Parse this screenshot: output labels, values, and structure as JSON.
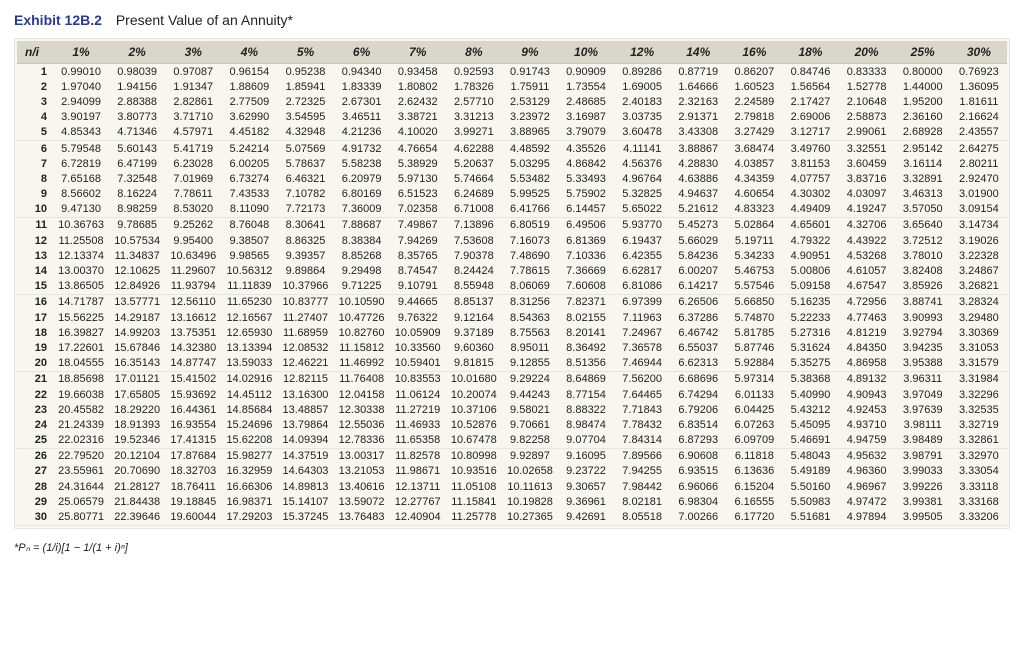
{
  "exhibit_label": "Exhibit 12B.2",
  "exhibit_title": "Present Value of an Annuity*",
  "row_header": "n/i",
  "columns": [
    "1%",
    "2%",
    "3%",
    "4%",
    "5%",
    "6%",
    "7%",
    "8%",
    "9%",
    "10%",
    "12%",
    "14%",
    "16%",
    "18%",
    "20%",
    "25%",
    "30%"
  ],
  "footnote": "*Pₙ = (1/i)[1 − 1/(1 + i)ⁿ]",
  "chart_data": {
    "type": "table",
    "title": "Exhibit 12B.2 Present Value of an Annuity",
    "x": [
      "1%",
      "2%",
      "3%",
      "4%",
      "5%",
      "6%",
      "7%",
      "8%",
      "9%",
      "10%",
      "12%",
      "14%",
      "16%",
      "18%",
      "20%",
      "25%",
      "30%"
    ],
    "rows": [
      {
        "n": 1,
        "v": [
          0.9901,
          0.98039,
          0.97087,
          0.96154,
          0.95238,
          0.9434,
          0.93458,
          0.92593,
          0.91743,
          0.90909,
          0.89286,
          0.87719,
          0.86207,
          0.84746,
          0.83333,
          0.8,
          0.76923
        ]
      },
      {
        "n": 2,
        "v": [
          1.9704,
          1.94156,
          1.91347,
          1.88609,
          1.85941,
          1.83339,
          1.80802,
          1.78326,
          1.75911,
          1.73554,
          1.69005,
          1.64666,
          1.60523,
          1.56564,
          1.52778,
          1.44,
          1.36095
        ]
      },
      {
        "n": 3,
        "v": [
          2.94099,
          2.88388,
          2.82861,
          2.77509,
          2.72325,
          2.67301,
          2.62432,
          2.5771,
          2.53129,
          2.48685,
          2.40183,
          2.32163,
          2.24589,
          2.17427,
          2.10648,
          1.952,
          1.81611
        ]
      },
      {
        "n": 4,
        "v": [
          3.90197,
          3.80773,
          3.7171,
          3.6299,
          3.54595,
          3.46511,
          3.38721,
          3.31213,
          3.23972,
          3.16987,
          3.03735,
          2.91371,
          2.79818,
          2.69006,
          2.58873,
          2.3616,
          2.16624
        ]
      },
      {
        "n": 5,
        "v": [
          4.85343,
          4.71346,
          4.57971,
          4.45182,
          4.32948,
          4.21236,
          4.1002,
          3.99271,
          3.88965,
          3.79079,
          3.60478,
          3.43308,
          3.27429,
          3.12717,
          2.99061,
          2.68928,
          2.43557
        ]
      },
      {
        "n": 6,
        "v": [
          5.79548,
          5.60143,
          5.41719,
          5.24214,
          5.07569,
          4.91732,
          4.76654,
          4.62288,
          4.48592,
          4.35526,
          4.11141,
          3.88867,
          3.68474,
          3.4976,
          3.32551,
          2.95142,
          2.64275
        ]
      },
      {
        "n": 7,
        "v": [
          6.72819,
          6.47199,
          6.23028,
          6.00205,
          5.78637,
          5.58238,
          5.38929,
          5.20637,
          5.03295,
          4.86842,
          4.56376,
          4.2883,
          4.03857,
          3.81153,
          3.60459,
          3.16114,
          2.80211
        ]
      },
      {
        "n": 8,
        "v": [
          7.65168,
          7.32548,
          7.01969,
          6.73274,
          6.46321,
          6.20979,
          5.9713,
          5.74664,
          5.53482,
          5.33493,
          4.96764,
          4.63886,
          4.34359,
          4.07757,
          3.83716,
          3.32891,
          2.9247
        ]
      },
      {
        "n": 9,
        "v": [
          8.56602,
          8.16224,
          7.78611,
          7.43533,
          7.10782,
          6.80169,
          6.51523,
          6.24689,
          5.99525,
          5.75902,
          5.32825,
          4.94637,
          4.60654,
          4.30302,
          4.03097,
          3.46313,
          3.019
        ]
      },
      {
        "n": 10,
        "v": [
          9.4713,
          8.98259,
          8.5302,
          8.1109,
          7.72173,
          7.36009,
          7.02358,
          6.71008,
          6.41766,
          6.14457,
          5.65022,
          5.21612,
          4.83323,
          4.49409,
          4.19247,
          3.5705,
          3.09154
        ]
      },
      {
        "n": 11,
        "v": [
          10.36763,
          9.78685,
          9.25262,
          8.76048,
          8.30641,
          7.88687,
          7.49867,
          7.13896,
          6.80519,
          6.49506,
          5.9377,
          5.45273,
          5.02864,
          4.65601,
          4.32706,
          3.6564,
          3.14734
        ]
      },
      {
        "n": 12,
        "v": [
          11.25508,
          10.57534,
          9.954,
          9.38507,
          8.86325,
          8.38384,
          7.94269,
          7.53608,
          7.16073,
          6.81369,
          6.19437,
          5.66029,
          5.19711,
          4.79322,
          4.43922,
          3.72512,
          3.19026
        ]
      },
      {
        "n": 13,
        "v": [
          12.13374,
          11.34837,
          10.63496,
          9.98565,
          9.39357,
          8.85268,
          8.35765,
          7.90378,
          7.4869,
          7.10336,
          6.42355,
          5.84236,
          5.34233,
          4.90951,
          4.53268,
          3.7801,
          3.22328
        ]
      },
      {
        "n": 14,
        "v": [
          13.0037,
          12.10625,
          11.29607,
          10.56312,
          9.89864,
          9.29498,
          8.74547,
          8.24424,
          7.78615,
          7.36669,
          6.62817,
          6.00207,
          5.46753,
          5.00806,
          4.61057,
          3.82408,
          3.24867
        ]
      },
      {
        "n": 15,
        "v": [
          13.86505,
          12.84926,
          11.93794,
          11.11839,
          10.37966,
          9.71225,
          9.10791,
          8.55948,
          8.06069,
          7.60608,
          6.81086,
          6.14217,
          5.57546,
          5.09158,
          4.67547,
          3.85926,
          3.26821
        ]
      },
      {
        "n": 16,
        "v": [
          14.71787,
          13.57771,
          12.5611,
          11.6523,
          10.83777,
          10.1059,
          9.44665,
          8.85137,
          8.31256,
          7.82371,
          6.97399,
          6.26506,
          5.6685,
          5.16235,
          4.72956,
          3.88741,
          3.28324
        ]
      },
      {
        "n": 17,
        "v": [
          15.56225,
          14.29187,
          13.16612,
          12.16567,
          11.27407,
          10.47726,
          9.76322,
          9.12164,
          8.54363,
          8.02155,
          7.11963,
          6.37286,
          5.7487,
          5.22233,
          4.77463,
          3.90993,
          3.2948
        ]
      },
      {
        "n": 18,
        "v": [
          16.39827,
          14.99203,
          13.75351,
          12.6593,
          11.68959,
          10.8276,
          10.05909,
          9.37189,
          8.75563,
          8.20141,
          7.24967,
          6.46742,
          5.81785,
          5.27316,
          4.81219,
          3.92794,
          3.30369
        ]
      },
      {
        "n": 19,
        "v": [
          17.22601,
          15.67846,
          14.3238,
          13.13394,
          12.08532,
          11.15812,
          10.3356,
          9.6036,
          8.95011,
          8.36492,
          7.36578,
          6.55037,
          5.87746,
          5.31624,
          4.8435,
          3.94235,
          3.31053
        ]
      },
      {
        "n": 20,
        "v": [
          18.04555,
          16.35143,
          14.87747,
          13.59033,
          12.46221,
          11.46992,
          10.59401,
          9.81815,
          9.12855,
          8.51356,
          7.46944,
          6.62313,
          5.92884,
          5.35275,
          4.86958,
          3.95388,
          3.31579
        ]
      },
      {
        "n": 21,
        "v": [
          18.85698,
          17.01121,
          15.41502,
          14.02916,
          12.82115,
          11.76408,
          10.83553,
          10.0168,
          9.29224,
          8.64869,
          7.562,
          6.68696,
          5.97314,
          5.38368,
          4.89132,
          3.96311,
          3.31984
        ]
      },
      {
        "n": 22,
        "v": [
          19.66038,
          17.65805,
          15.93692,
          14.45112,
          13.163,
          12.04158,
          11.06124,
          10.20074,
          9.44243,
          8.77154,
          7.64465,
          6.74294,
          6.01133,
          5.4099,
          4.90943,
          3.97049,
          3.32296
        ]
      },
      {
        "n": 23,
        "v": [
          20.45582,
          18.2922,
          16.44361,
          14.85684,
          13.48857,
          12.30338,
          11.27219,
          10.37106,
          9.58021,
          8.88322,
          7.71843,
          6.79206,
          6.04425,
          5.43212,
          4.92453,
          3.97639,
          3.32535
        ]
      },
      {
        "n": 24,
        "v": [
          21.24339,
          18.91393,
          16.93554,
          15.24696,
          13.79864,
          12.55036,
          11.46933,
          10.52876,
          9.70661,
          8.98474,
          7.78432,
          6.83514,
          6.07263,
          5.45095,
          4.9371,
          3.98111,
          3.32719
        ]
      },
      {
        "n": 25,
        "v": [
          22.02316,
          19.52346,
          17.41315,
          15.62208,
          14.09394,
          12.78336,
          11.65358,
          10.67478,
          9.82258,
          9.07704,
          7.84314,
          6.87293,
          6.09709,
          5.46691,
          4.94759,
          3.98489,
          3.32861
        ]
      },
      {
        "n": 26,
        "v": [
          22.7952,
          20.12104,
          17.87684,
          15.98277,
          14.37519,
          13.00317,
          11.82578,
          10.80998,
          9.92897,
          9.16095,
          7.89566,
          6.90608,
          6.11818,
          5.48043,
          4.95632,
          3.98791,
          3.3297
        ]
      },
      {
        "n": 27,
        "v": [
          23.55961,
          20.7069,
          18.32703,
          16.32959,
          14.64303,
          13.21053,
          11.98671,
          10.93516,
          10.02658,
          9.23722,
          7.94255,
          6.93515,
          6.13636,
          5.49189,
          4.9636,
          3.99033,
          3.33054
        ]
      },
      {
        "n": 28,
        "v": [
          24.31644,
          21.28127,
          18.76411,
          16.66306,
          14.89813,
          13.40616,
          12.13711,
          11.05108,
          10.11613,
          9.30657,
          7.98442,
          6.96066,
          6.15204,
          5.5016,
          4.96967,
          3.99226,
          3.33118
        ]
      },
      {
        "n": 29,
        "v": [
          25.06579,
          21.84438,
          19.18845,
          16.98371,
          15.14107,
          13.59072,
          12.27767,
          11.15841,
          10.19828,
          9.36961,
          8.02181,
          6.98304,
          6.16555,
          5.50983,
          4.97472,
          3.99381,
          3.33168
        ]
      },
      {
        "n": 30,
        "v": [
          25.80771,
          22.39646,
          19.60044,
          17.29203,
          15.37245,
          13.76483,
          12.40904,
          11.25778,
          10.27365,
          9.42691,
          8.05518,
          7.00266,
          6.1772,
          5.51681,
          4.97894,
          3.99505,
          3.33206
        ]
      }
    ]
  }
}
